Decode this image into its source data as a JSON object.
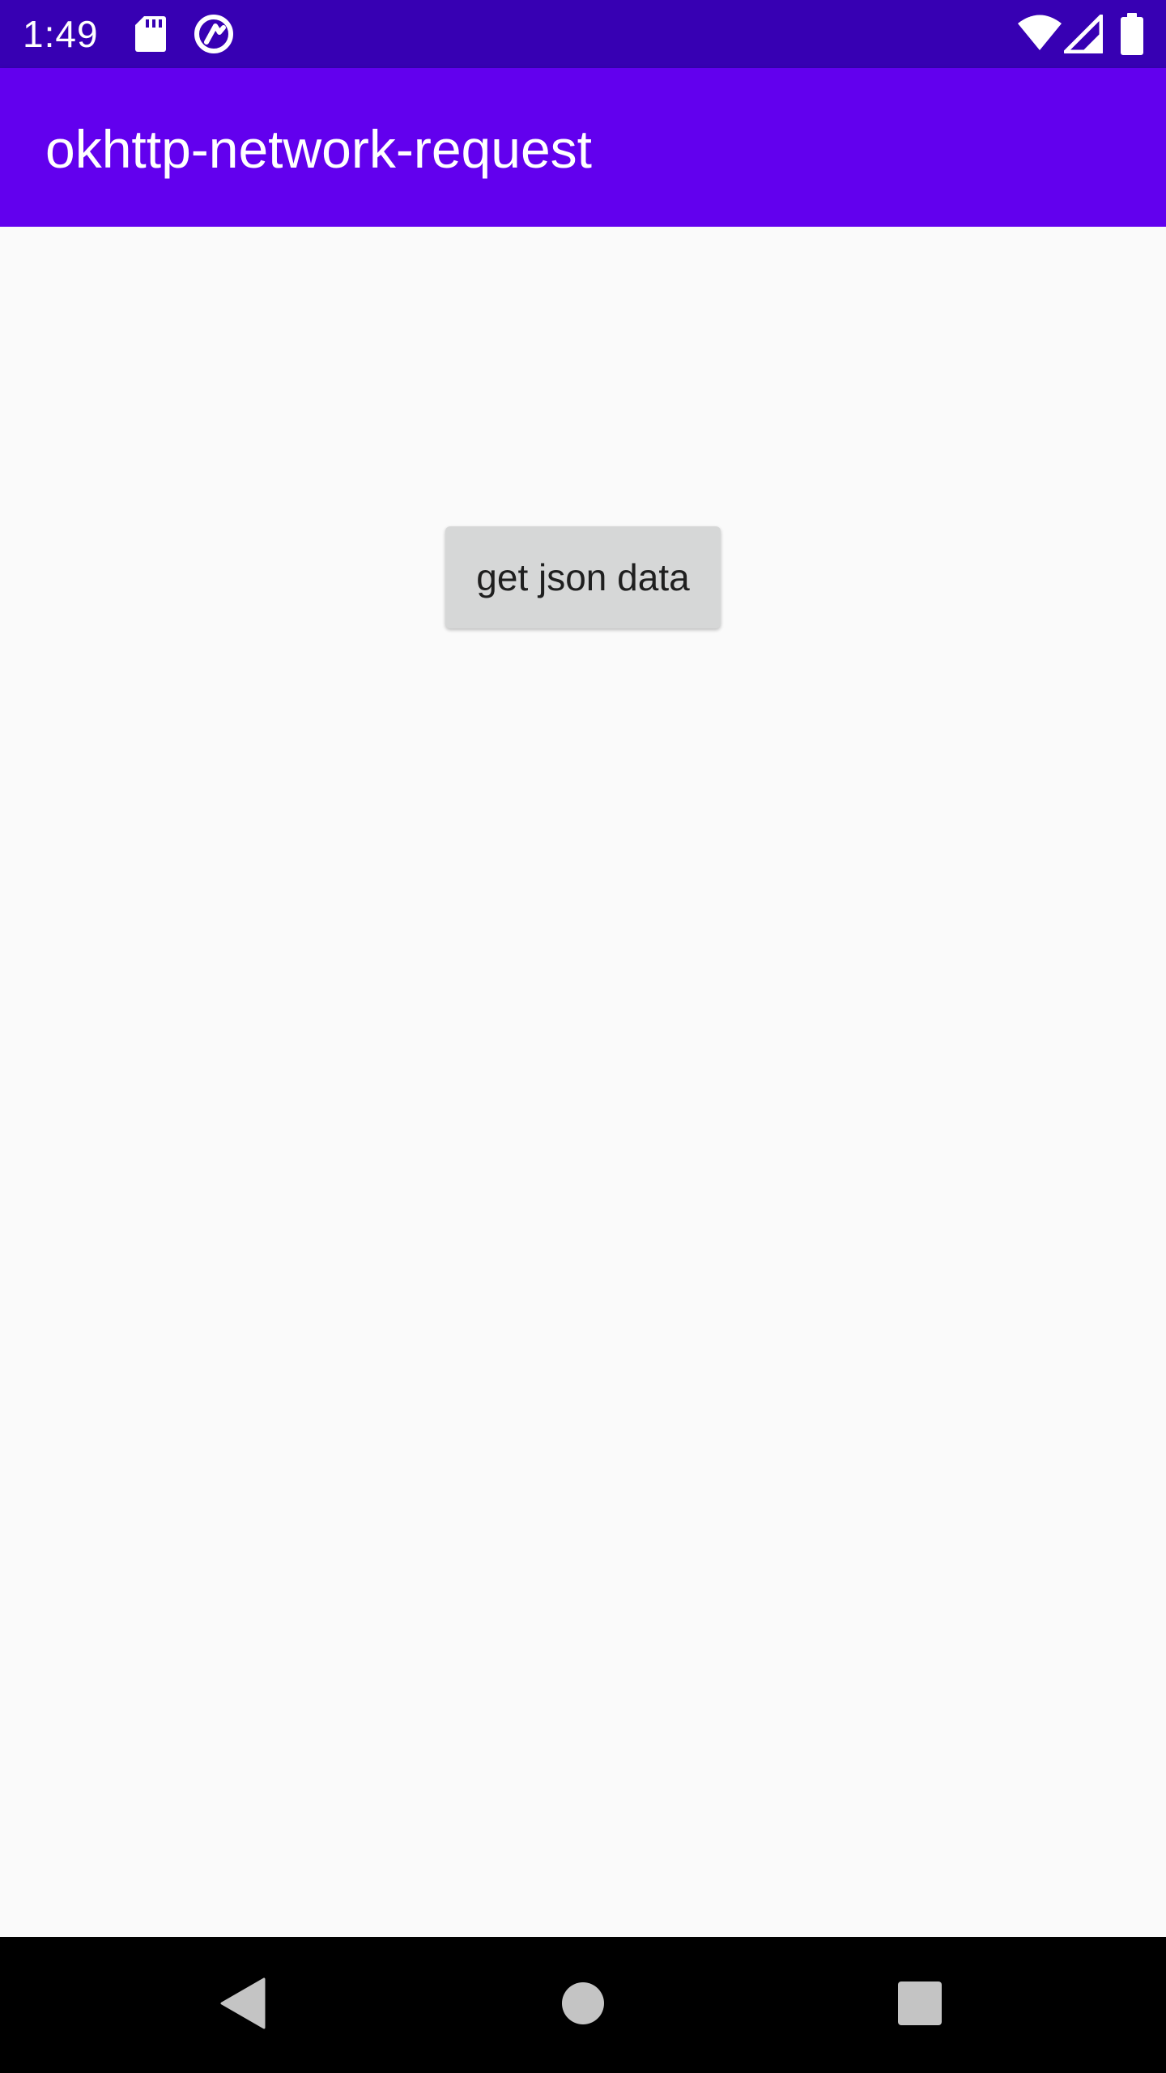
{
  "status_bar": {
    "time": "1:49",
    "icons": [
      "sd-card-icon",
      "sync-icon",
      "wifi-icon",
      "signal-icon",
      "battery-icon"
    ]
  },
  "app_bar": {
    "title": "okhttp-network-request"
  },
  "main": {
    "get_json_button_label": "get json data"
  },
  "nav_bar": {
    "buttons": [
      "back-icon",
      "home-icon",
      "recents-icon"
    ]
  },
  "colors": {
    "status_bar": "#3700b3",
    "app_bar": "#6200ee",
    "background": "#fafafa",
    "button": "#d6d7d7",
    "nav_bar": "#000000"
  }
}
